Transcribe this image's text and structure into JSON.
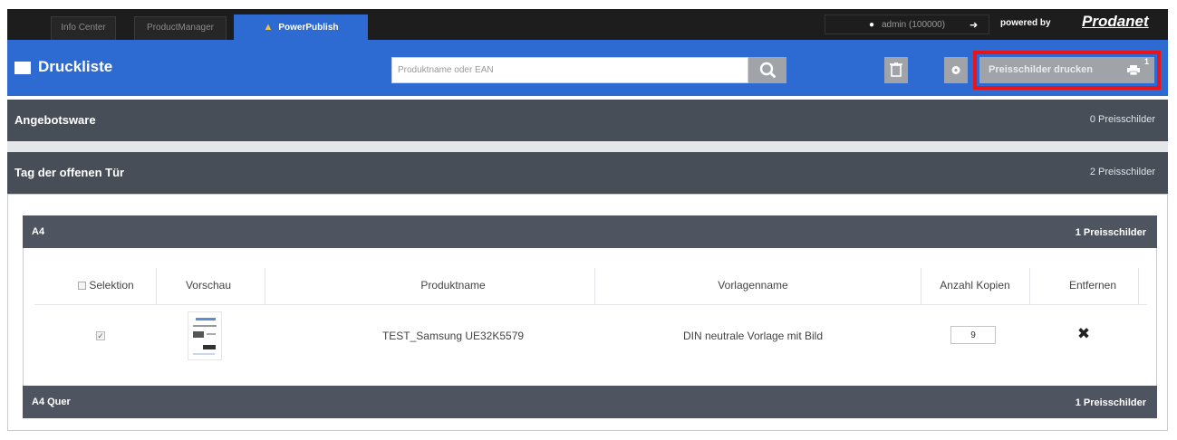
{
  "tabs": [
    {
      "label": "Info Center"
    },
    {
      "label": "ProductManager"
    },
    {
      "label": "PowerPublish"
    }
  ],
  "topbar": {
    "user": "admin (100000)",
    "powered_by": "powered by",
    "brand": "Prodanet"
  },
  "header": {
    "title": "Druckliste",
    "search_placeholder": "Produktname oder EAN",
    "print_button_label": "Preisschilder drucken",
    "print_badge": "1"
  },
  "sections": [
    {
      "title": "Angebotsware",
      "count": "0 Preisschilder"
    },
    {
      "title": "Tag der offenen Tür",
      "count": "2 Preisschilder"
    }
  ],
  "subgroups": [
    {
      "title": "A4",
      "count": "1 Preisschilder"
    },
    {
      "title": "A4 Quer",
      "count": "1 Preisschilder"
    }
  ],
  "table": {
    "headers": [
      "Selektion",
      "Vorschau",
      "Produktname",
      "Vorlagenname",
      "Anzahl Kopien",
      "Entfernen"
    ],
    "rows": [
      {
        "product": "TEST_Samsung UE32K5579",
        "template": "DIN neutrale Vorlage mit Bild",
        "copies": "9",
        "selected": true
      }
    ]
  },
  "colors": {
    "accent": "#2d6bd3",
    "section_bg": "#484e57",
    "highlight": "#e8141a"
  }
}
